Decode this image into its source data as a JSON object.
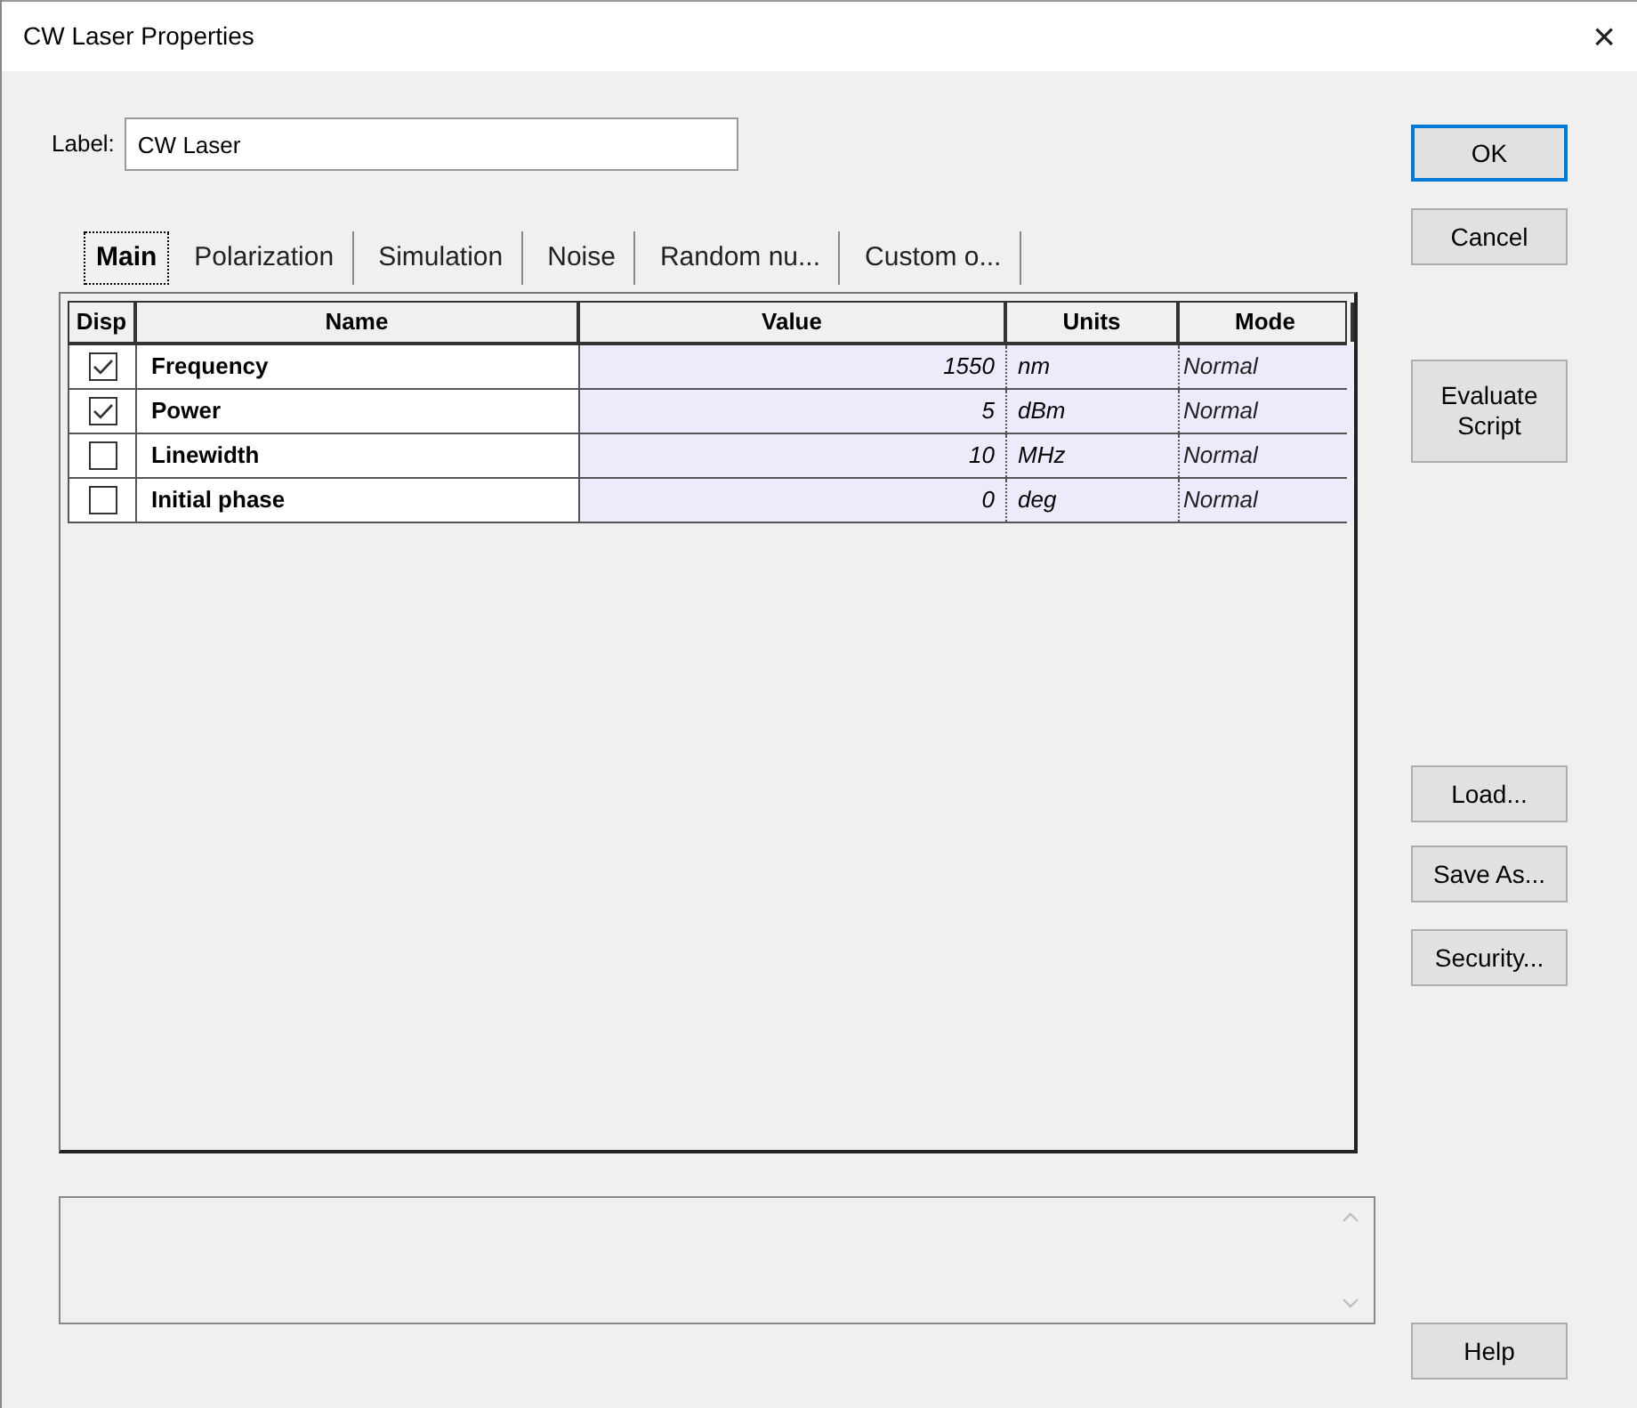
{
  "window": {
    "title": "CW Laser Properties",
    "close": "×"
  },
  "label": {
    "text": "Label:",
    "value": "CW Laser"
  },
  "tabs": [
    {
      "label": "Main",
      "selected": true
    },
    {
      "label": "Polarization",
      "selected": false
    },
    {
      "label": "Simulation",
      "selected": false
    },
    {
      "label": "Noise",
      "selected": false
    },
    {
      "label": "Random nu...",
      "selected": false
    },
    {
      "label": "Custom o...",
      "selected": false
    }
  ],
  "table": {
    "columns": [
      "Disp",
      "Name",
      "Value",
      "Units",
      "Mode"
    ],
    "rows": [
      {
        "checked": true,
        "name": "Frequency",
        "value": "1550",
        "units": "nm",
        "mode": "Normal"
      },
      {
        "checked": true,
        "name": "Power",
        "value": "5",
        "units": "dBm",
        "mode": "Normal"
      },
      {
        "checked": false,
        "name": "Linewidth",
        "value": "10",
        "units": "MHz",
        "mode": "Normal"
      },
      {
        "checked": false,
        "name": "Initial phase",
        "value": "0",
        "units": "deg",
        "mode": "Normal"
      }
    ]
  },
  "buttons": {
    "ok": "OK",
    "cancel": "Cancel",
    "evaluate": "Evaluate Script",
    "load": "Load...",
    "save_as": "Save As...",
    "security": "Security...",
    "help": "Help"
  }
}
